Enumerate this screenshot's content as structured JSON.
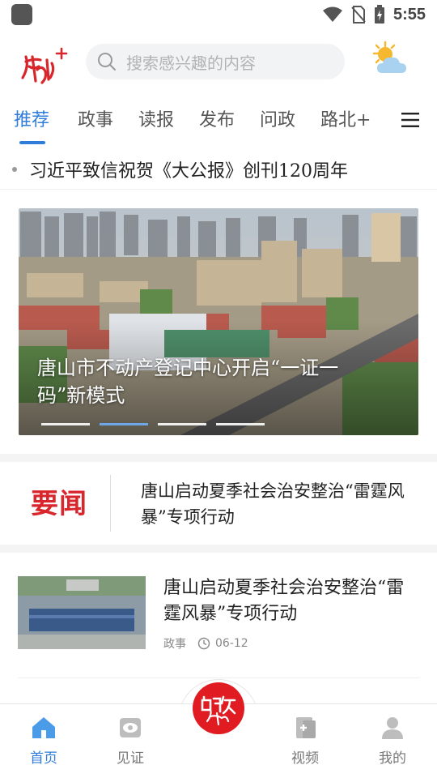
{
  "status": {
    "time": "5:55"
  },
  "header": {
    "search_placeholder": "搜索感兴趣的内容"
  },
  "tabs": [
    {
      "label": "推荐",
      "active": true
    },
    {
      "label": "政事"
    },
    {
      "label": "读报"
    },
    {
      "label": "发布"
    },
    {
      "label": "问政"
    },
    {
      "label": "路北+"
    }
  ],
  "ticker": {
    "text": "习近平致信祝贺《大公报》创刊120周年"
  },
  "banner": {
    "caption": "唐山市不动产登记中心开启“一证一码”新模式",
    "dots": 4,
    "active_dot": 1
  },
  "headline": {
    "badge": "要闻",
    "text": "唐山启动夏季社会治安整治“雷霆风暴”专项行动"
  },
  "news": [
    {
      "title": "唐山启动夏季社会治安整治“雷霆风暴”专项行动",
      "category": "政事",
      "date": "06-12"
    }
  ],
  "nav": [
    {
      "label": "首页",
      "icon": "home-icon",
      "active": true
    },
    {
      "label": "见证",
      "icon": "eye-icon"
    },
    {
      "label": "问政",
      "icon": "wenzheng-icon"
    },
    {
      "label": "视频",
      "icon": "video-icon"
    },
    {
      "label": "我的",
      "icon": "user-icon"
    }
  ],
  "colors": {
    "accent": "#2f7dd8",
    "brand_red": "#d8262c"
  }
}
